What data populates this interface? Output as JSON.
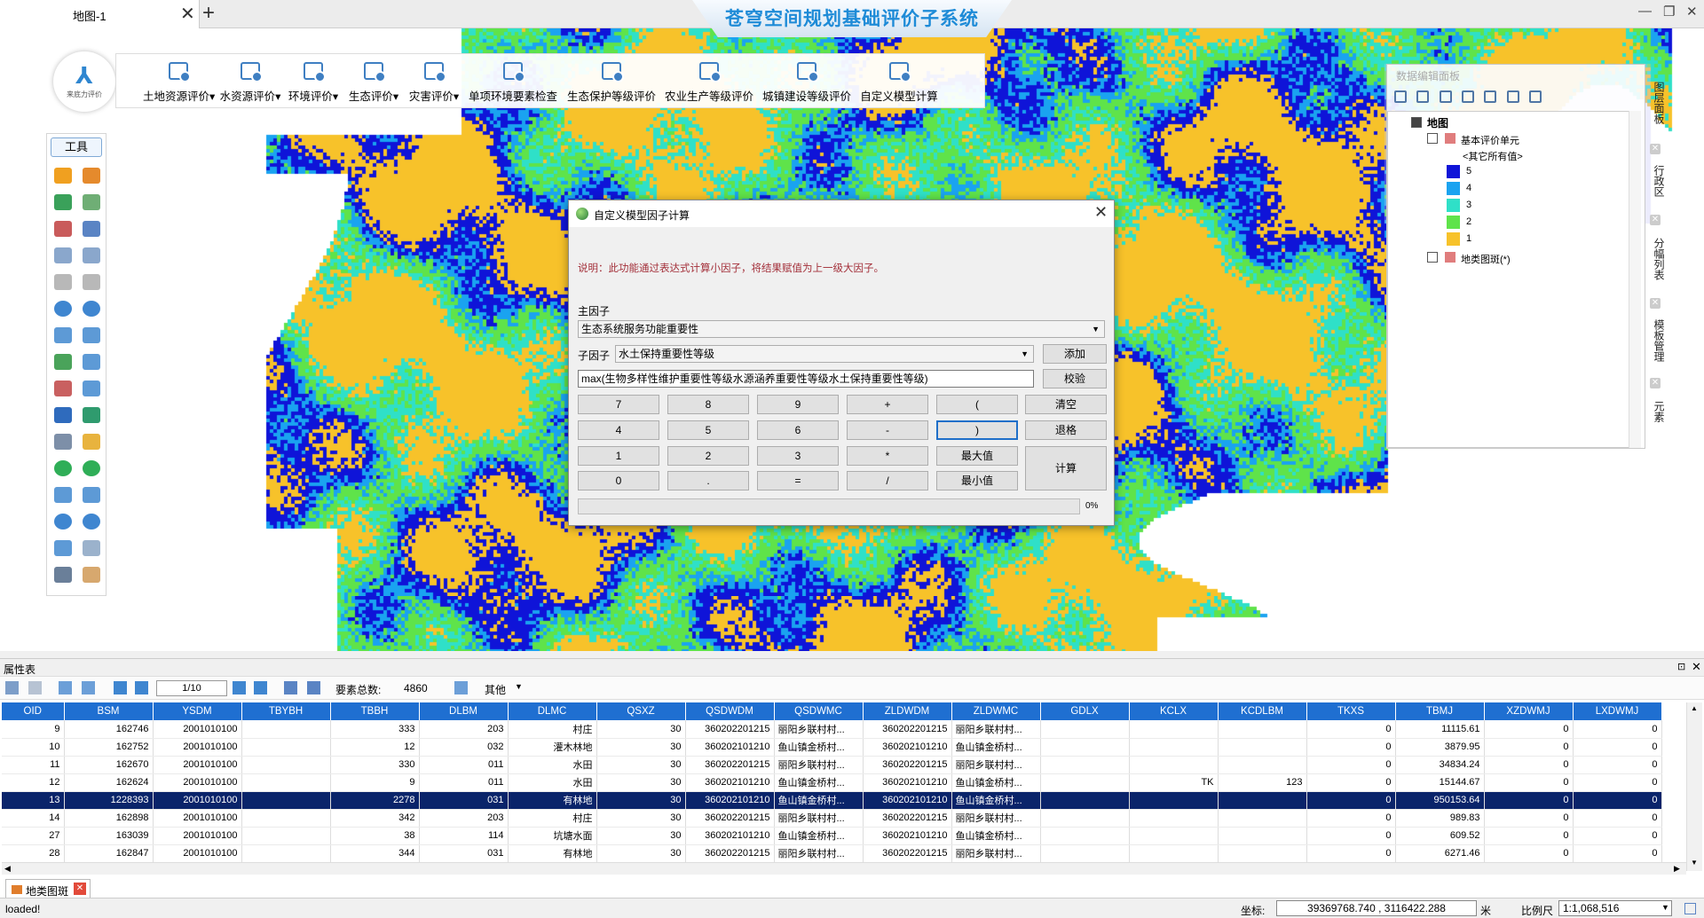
{
  "window": {
    "tab_label": "地图-1",
    "tab_close": "✕",
    "tab_add": "+",
    "app_title": "苍穹空间规划基础评价子系统",
    "minimize": "—",
    "maximize": "❐",
    "close": "✕"
  },
  "logo": {
    "mark": "⅄",
    "text": "来底力评价"
  },
  "ribbon": [
    {
      "label": "土地资源评价▾"
    },
    {
      "label": "水资源评价▾"
    },
    {
      "label": "环境评价▾"
    },
    {
      "label": "生态评价▾"
    },
    {
      "label": "灾害评价▾"
    },
    {
      "label": "单项环境要素检查"
    },
    {
      "label": "生态保护等级评价"
    },
    {
      "label": "农业生产等级评价"
    },
    {
      "label": "城镇建设等级评价"
    },
    {
      "label": "自定义模型计算"
    }
  ],
  "toolbox": {
    "title": "工具"
  },
  "legend_panel": {
    "title": "数据编辑面板",
    "root": "地图",
    "layer1": "基本评价单元",
    "other_values": "<其它所有值>",
    "classes": [
      {
        "label": "5",
        "color": "#0f14d8"
      },
      {
        "label": "4",
        "color": "#1aa3f0"
      },
      {
        "label": "3",
        "color": "#2fe0c8"
      },
      {
        "label": "2",
        "color": "#5fe34a"
      },
      {
        "label": "1",
        "color": "#f7c22a"
      }
    ],
    "layer2": "地类图斑(*)",
    "layer_swatch": "#e07d7d"
  },
  "side_tabs": [
    "图层面板",
    "行政区",
    "分幅列表",
    "模板管理",
    "元素"
  ],
  "side_close": "✕",
  "dialog": {
    "title": "自定义模型因子计算",
    "close": "✕",
    "description": "说明：此功能通过表达式计算小因子，将结果赋值为上一级大因子。",
    "main_factor_label": "主因子",
    "main_factor_value": "生态系统服务功能重要性",
    "sub_factor_label": "子因子",
    "sub_factor_value": "水土保持重要性等级",
    "add_button": "添加",
    "expression": "max(生物多样性维护重要性等级水源涵养重要性等级水土保持重要性等级)",
    "validate_button": "校验",
    "keys_row1": [
      "7",
      "8",
      "9",
      "+",
      "("
    ],
    "keys_row2": [
      "4",
      "5",
      "6",
      "-",
      ")"
    ],
    "keys_row3": [
      "1",
      "2",
      "3",
      "*",
      "最大值"
    ],
    "keys_row4": [
      "0",
      ".",
      "=",
      "/",
      "最小值"
    ],
    "clear_button": "清空",
    "backspace_button": "退格",
    "compute_button": "计算",
    "progress_label": "0%",
    "progress": 0,
    "arrow": "▼"
  },
  "attr_table": {
    "title": "属性表",
    "pin": "⊡",
    "close": "✕",
    "page": "1/10",
    "total_label": "要素总数:",
    "total_value": "4860",
    "other_label": "其他",
    "columns": [
      "OID",
      "BSM",
      "YSDM",
      "TBYBH",
      "TBBH",
      "DLBM",
      "DLMC",
      "QSXZ",
      "QSDWDM",
      "QSDWMC",
      "ZLDWDM",
      "ZLDWMC",
      "GDLX",
      "KCLX",
      "KCDLBM",
      "TKXS",
      "TBMJ",
      "XZDWMJ",
      "LXDWMJ"
    ],
    "rows": [
      [
        "9",
        "162746",
        "2001010100",
        "",
        "333",
        "203",
        "村庄",
        "30",
        "360202201215",
        "丽阳乡联村村...",
        "360202201215",
        "丽阳乡联村村...",
        "",
        "",
        "",
        "0",
        "11115.61",
        "0",
        "0"
      ],
      [
        "10",
        "162752",
        "2001010100",
        "",
        "12",
        "032",
        "灌木林地",
        "30",
        "360202101210",
        "鱼山镇金桥村...",
        "360202101210",
        "鱼山镇金桥村...",
        "",
        "",
        "",
        "0",
        "3879.95",
        "0",
        "0"
      ],
      [
        "11",
        "162670",
        "2001010100",
        "",
        "330",
        "011",
        "水田",
        "30",
        "360202201215",
        "丽阳乡联村村...",
        "360202201215",
        "丽阳乡联村村...",
        "",
        "",
        "",
        "0",
        "34834.24",
        "0",
        "0"
      ],
      [
        "12",
        "162624",
        "2001010100",
        "",
        "9",
        "011",
        "水田",
        "30",
        "360202101210",
        "鱼山镇金桥村...",
        "360202101210",
        "鱼山镇金桥村...",
        "",
        "TK",
        "123",
        "0",
        "15144.67",
        "0",
        "0"
      ],
      [
        "13",
        "1228393",
        "2001010100",
        "",
        "2278",
        "031",
        "有林地",
        "30",
        "360202101210",
        "鱼山镇金桥村...",
        "360202101210",
        "鱼山镇金桥村...",
        "",
        "",
        "",
        "0",
        "950153.64",
        "0",
        "0"
      ],
      [
        "14",
        "162898",
        "2001010100",
        "",
        "342",
        "203",
        "村庄",
        "30",
        "360202201215",
        "丽阳乡联村村...",
        "360202201215",
        "丽阳乡联村村...",
        "",
        "",
        "",
        "0",
        "989.83",
        "0",
        "0"
      ],
      [
        "27",
        "163039",
        "2001010100",
        "",
        "38",
        "114",
        "坑塘水面",
        "30",
        "360202101210",
        "鱼山镇金桥村...",
        "360202101210",
        "鱼山镇金桥村...",
        "",
        "",
        "",
        "0",
        "609.52",
        "0",
        "0"
      ],
      [
        "28",
        "162847",
        "2001010100",
        "",
        "344",
        "031",
        "有林地",
        "30",
        "360202201215",
        "丽阳乡联村村...",
        "360202201215",
        "丽阳乡联村村...",
        "",
        "",
        "",
        "0",
        "6271.46",
        "0",
        "0"
      ]
    ],
    "bottom_tab": "地类图斑",
    "scroll_up": "▲",
    "scroll_down": "▼",
    "scroll_left": "◀",
    "scroll_right": "▶"
  },
  "status": {
    "message": "loaded!",
    "coord_label": "坐标:",
    "coord_value": "39369768.740 , 3116422.288",
    "unit": "米",
    "scale_label": "比例尺",
    "scale_value": "1:1,068,516"
  }
}
